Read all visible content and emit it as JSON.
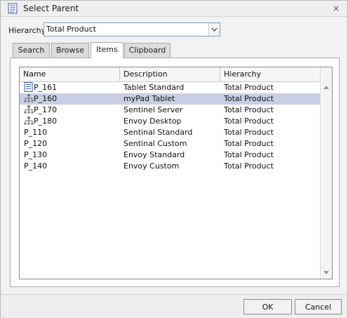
{
  "window": {
    "title": "Select Parent",
    "close_label": "×"
  },
  "hierarchy": {
    "label": "Hierarchy",
    "selected": "Total Product"
  },
  "tabs": [
    {
      "label": "Search",
      "active": false
    },
    {
      "label": "Browse",
      "active": false
    },
    {
      "label": "Items",
      "active": true
    },
    {
      "label": "Clipboard",
      "active": false
    }
  ],
  "grid": {
    "columns": [
      "Name",
      "Description",
      "Hierarchy"
    ],
    "rows": [
      {
        "name": "P_161",
        "description": "Tablet Standard",
        "hierarchy": "Total Product",
        "icon": "document-icon",
        "selected": false
      },
      {
        "name": "P_160",
        "description": "myPad Tablet",
        "hierarchy": "Total Product",
        "icon": "hierarchy-icon",
        "selected": true
      },
      {
        "name": "P_170",
        "description": "Sentinel Server",
        "hierarchy": "Total Product",
        "icon": "hierarchy-icon",
        "selected": false
      },
      {
        "name": "P_180",
        "description": "Envoy Desktop",
        "hierarchy": "Total Product",
        "icon": "hierarchy-icon",
        "selected": false
      },
      {
        "name": "P_110",
        "description": "Sentinal Standard",
        "hierarchy": "Total Product",
        "icon": "",
        "selected": false
      },
      {
        "name": "P_120",
        "description": "Sentinal Custom",
        "hierarchy": "Total Product",
        "icon": "",
        "selected": false
      },
      {
        "name": "P_130",
        "description": "Envoy Standard",
        "hierarchy": "Total Product",
        "icon": "",
        "selected": false
      },
      {
        "name": "P_140",
        "description": "Envoy Custom",
        "hierarchy": "Total Product",
        "icon": "",
        "selected": false
      }
    ]
  },
  "buttons": {
    "ok": "OK",
    "cancel": "Cancel"
  },
  "colors": {
    "selected_row": "#c8cfe4",
    "icon_blue": "#3a5fa8"
  }
}
